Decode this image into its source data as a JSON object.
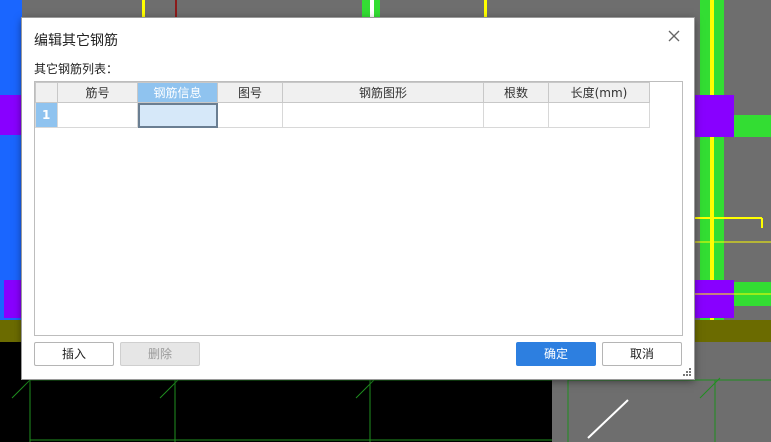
{
  "dialog": {
    "title": "编辑其它钢筋",
    "list_label": "其它钢筋列表：",
    "columns": [
      "筋号",
      "钢筋信息",
      "图号",
      "钢筋图形",
      "根数",
      "长度(mm)"
    ],
    "active_column": "钢筋信息",
    "rows": [
      {
        "num": "1",
        "cells": [
          "",
          "",
          "",
          "",
          "",
          ""
        ]
      }
    ],
    "buttons": {
      "insert": "插入",
      "delete": "删除",
      "ok": "确定",
      "cancel": "取消"
    }
  },
  "colors": {
    "accent": "#2d7fe0",
    "header_active": "#8fc3ef",
    "cell_selected": "#d6e8f9",
    "cad_green": "#33dd33",
    "cad_purple": "#8800ff",
    "cad_blue": "#1a66ff",
    "cad_yellow": "#ffff00"
  },
  "icons": {
    "close": "close-icon",
    "resize": "resize-grip-icon"
  }
}
